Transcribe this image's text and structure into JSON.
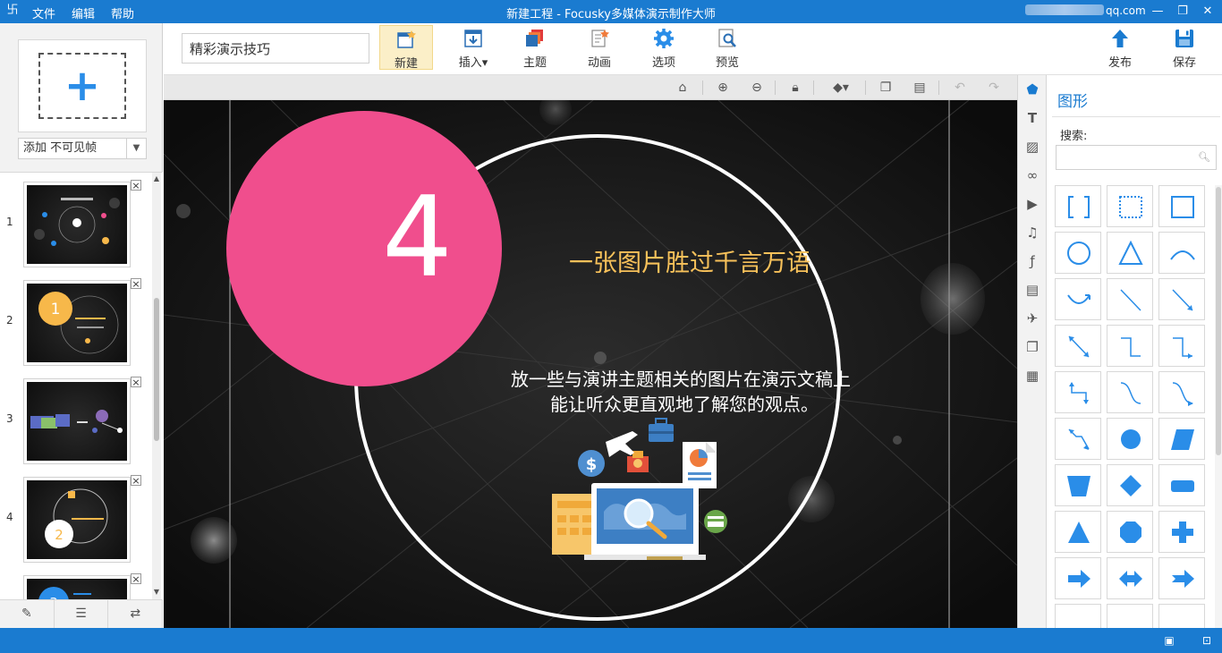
{
  "app": {
    "logo_glyph": "卐",
    "title": "新建工程 - Focusky多媒体演示制作大师",
    "menu": [
      "文件",
      "编辑",
      "帮助"
    ],
    "account_suffix": "qq.com",
    "window_controls": [
      "—",
      "❐",
      "✕"
    ]
  },
  "left_panel": {
    "add_glyph": "+",
    "add_select_value": "添加 不可见帧",
    "frames": [
      {
        "num": "1"
      },
      {
        "num": "2",
        "badge": "1"
      },
      {
        "num": "3"
      },
      {
        "num": "4",
        "badge": "2"
      },
      {
        "num": "",
        "badge": "3"
      }
    ],
    "bottom_icons": [
      "edit-icon",
      "list-star-icon",
      "swap-icon"
    ]
  },
  "toolbar": {
    "project_name": "精彩演示技巧",
    "buttons": [
      {
        "label": "新建",
        "icon": "new-icon",
        "active": true
      },
      {
        "label": "插入",
        "icon": "insert-icon",
        "dropdown": "▾"
      },
      {
        "label": "主题",
        "icon": "theme-icon"
      },
      {
        "label": "动画",
        "icon": "animation-icon"
      },
      {
        "label": "选项",
        "icon": "gear-icon"
      },
      {
        "label": "预览",
        "icon": "preview-icon"
      }
    ],
    "right_buttons": [
      {
        "label": "发布",
        "icon": "publish-icon"
      },
      {
        "label": "保存",
        "icon": "save-icon"
      }
    ]
  },
  "canvas": {
    "big_number": "4",
    "heading": "一张图片胜过千言万语",
    "body_line1": "放一些与演讲主题相关的图片在演示文稿上",
    "body_line2": "能让听众更直观地了解您的观点。",
    "colors": {
      "pink": "#f04e8d",
      "heading": "#f7c15a",
      "bg": "#111111"
    }
  },
  "right_panel": {
    "title": "图形",
    "search_label": "搜索:",
    "search_placeholder": "",
    "strip_icons": [
      "shapes-icon",
      "text-icon",
      "image-icon",
      "link-icon",
      "video-icon",
      "music-icon",
      "flash-icon",
      "document-icon",
      "plane-icon",
      "layers-icon",
      "layout-icon"
    ],
    "shapes": [
      "bracket",
      "dotted-rect",
      "rect",
      "circle",
      "triangle",
      "arc",
      "arc-curve",
      "line",
      "arrow-line",
      "double-arrow-line",
      "elbow",
      "elbow-arrow",
      "elbow-double",
      "curve",
      "curve-arrow",
      "zigzag-arrow",
      "filled-circle",
      "parallelogram",
      "trapezoid",
      "diamond",
      "rounded-rect",
      "filled-triangle",
      "octagon",
      "cross",
      "arrow-right",
      "arrow-both",
      "arrow-right-notched"
    ]
  },
  "status": {
    "icons": [
      "present-icon",
      "unlock-icon"
    ]
  }
}
